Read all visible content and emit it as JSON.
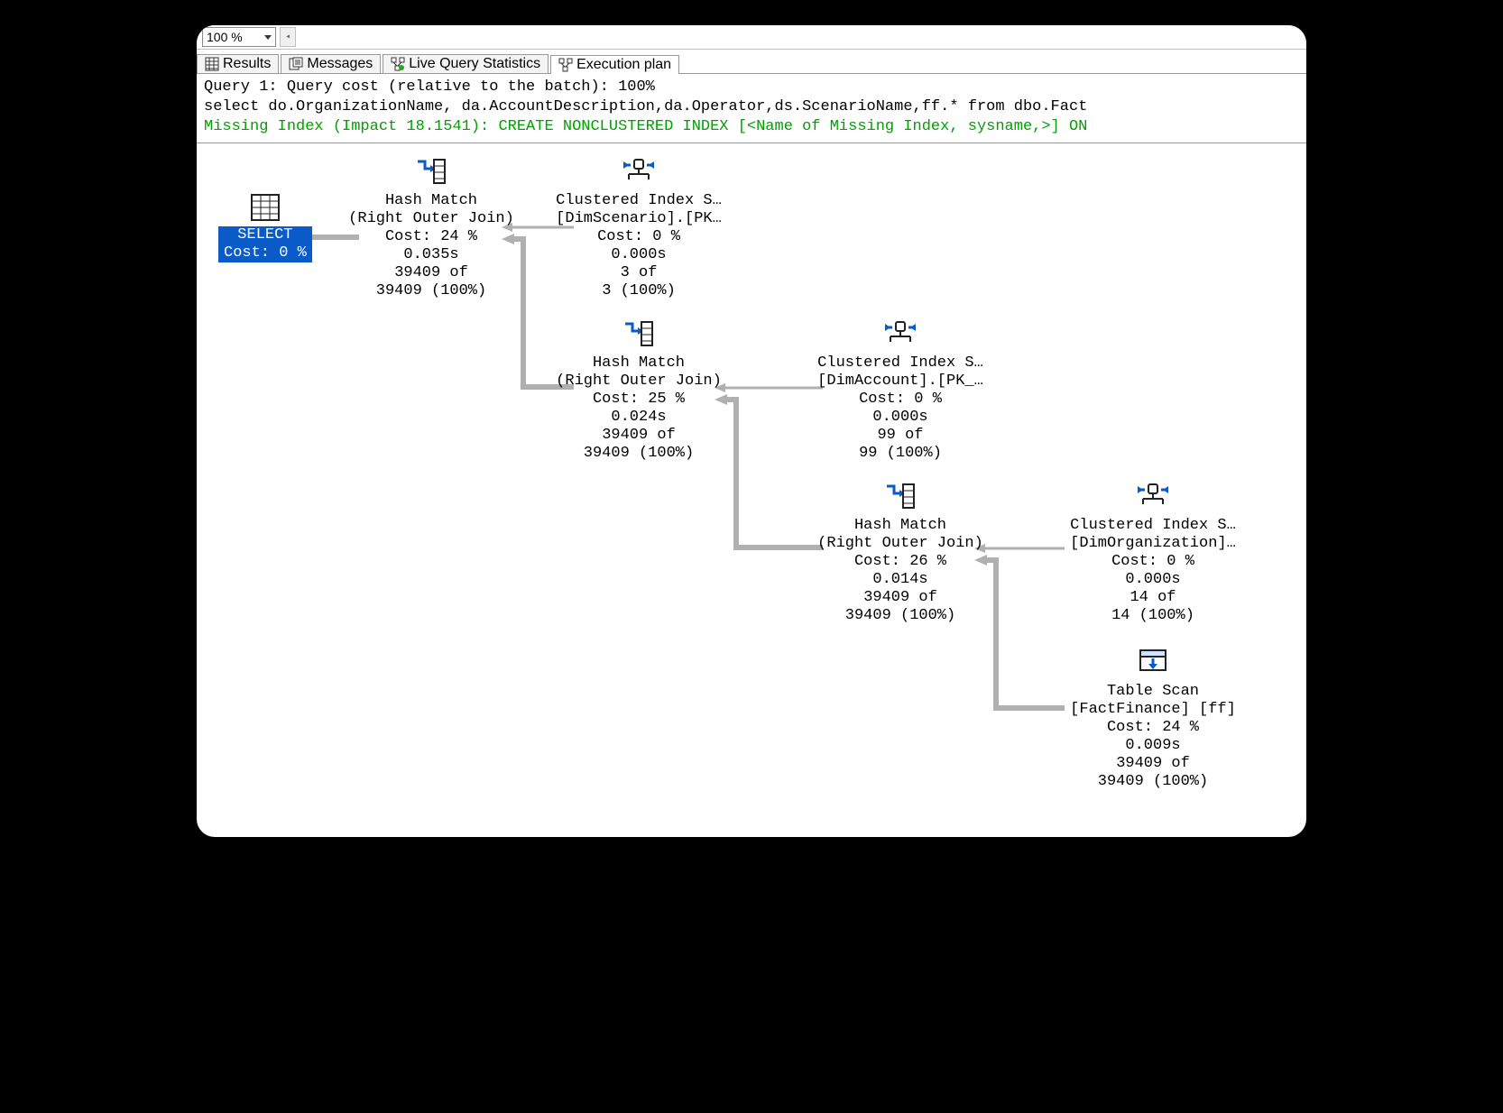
{
  "zoom": "100 %",
  "tabs": {
    "results": "Results",
    "messages": "Messages",
    "live": "Live Query Statistics",
    "exec": "Execution plan"
  },
  "query_line1": "Query 1: Query cost (relative to the batch): 100%",
  "query_line2": "select do.OrganizationName, da.AccountDescription,da.Operator,ds.ScenarioName,ff.* from dbo.Fact",
  "query_line3": "Missing Index (Impact 18.1541): CREATE NONCLUSTERED INDEX [<Name of Missing Index, sysname,>] ON",
  "select_label": "SELECT",
  "select_cost": "Cost: 0 %",
  "op_hm1_title": "Hash Match",
  "op_hm1_sub": "(Right Outer Join)",
  "op_hm1_cost": "Cost: 24 %",
  "op_hm1_time": "0.035s",
  "op_hm1_rows1": "39409 of",
  "op_hm1_rows2": "39409 (100%)",
  "op_cis1_title": "Clustered Index S…",
  "op_cis1_sub": "[DimScenario].[PK…",
  "op_cis1_cost": "Cost: 0 %",
  "op_cis1_time": "0.000s",
  "op_cis1_rows1": "3 of",
  "op_cis1_rows2": "3 (100%)",
  "op_hm2_title": "Hash Match",
  "op_hm2_sub": "(Right Outer Join)",
  "op_hm2_cost": "Cost: 25 %",
  "op_hm2_time": "0.024s",
  "op_hm2_rows1": "39409 of",
  "op_hm2_rows2": "39409 (100%)",
  "op_cis2_title": "Clustered Index S…",
  "op_cis2_sub": "[DimAccount].[PK_…",
  "op_cis2_cost": "Cost: 0 %",
  "op_cis2_time": "0.000s",
  "op_cis2_rows1": "99 of",
  "op_cis2_rows2": "99 (100%)",
  "op_hm3_title": "Hash Match",
  "op_hm3_sub": "(Right Outer Join)",
  "op_hm3_cost": "Cost: 26 %",
  "op_hm3_time": "0.014s",
  "op_hm3_rows1": "39409 of",
  "op_hm3_rows2": "39409 (100%)",
  "op_cis3_title": "Clustered Index S…",
  "op_cis3_sub": "[DimOrganization]…",
  "op_cis3_cost": "Cost: 0 %",
  "op_cis3_time": "0.000s",
  "op_cis3_rows1": "14 of",
  "op_cis3_rows2": "14 (100%)",
  "op_ts_title": "Table Scan",
  "op_ts_sub": "[FactFinance] [ff]",
  "op_ts_cost": "Cost: 24 %",
  "op_ts_time": "0.009s",
  "op_ts_rows1": "39409 of",
  "op_ts_rows2": "39409 (100%)"
}
